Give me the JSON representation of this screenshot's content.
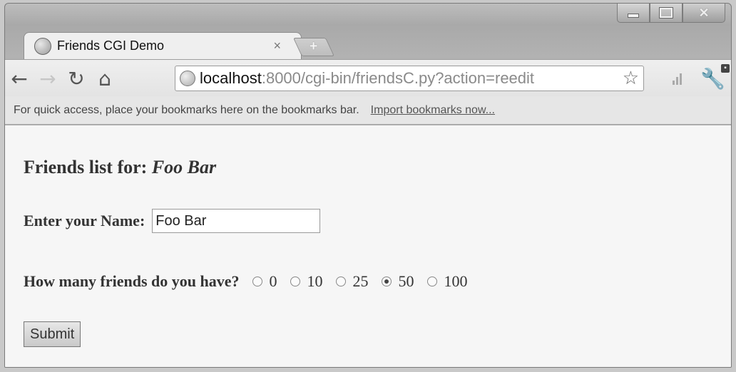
{
  "tab": {
    "title": "Friends CGI Demo",
    "close": "×"
  },
  "toolbar": {
    "url_host": "localhost",
    "url_rest": ":8000/cgi-bin/friendsC.py?action=reedit"
  },
  "bookmarks": {
    "message": "For quick access, place your bookmarks here on the bookmarks bar.",
    "import_link": "Import bookmarks now..."
  },
  "page": {
    "heading_prefix": "Friends list for:",
    "heading_name": "Foo Bar",
    "name_label": "Enter your Name:",
    "name_value": "Foo Bar",
    "friends_question": "How many friends do you have?",
    "friend_options": [
      {
        "label": "0",
        "checked": false
      },
      {
        "label": "10",
        "checked": false
      },
      {
        "label": "25",
        "checked": false
      },
      {
        "label": "50",
        "checked": true
      },
      {
        "label": "100",
        "checked": false
      }
    ],
    "submit_label": "Submit"
  }
}
